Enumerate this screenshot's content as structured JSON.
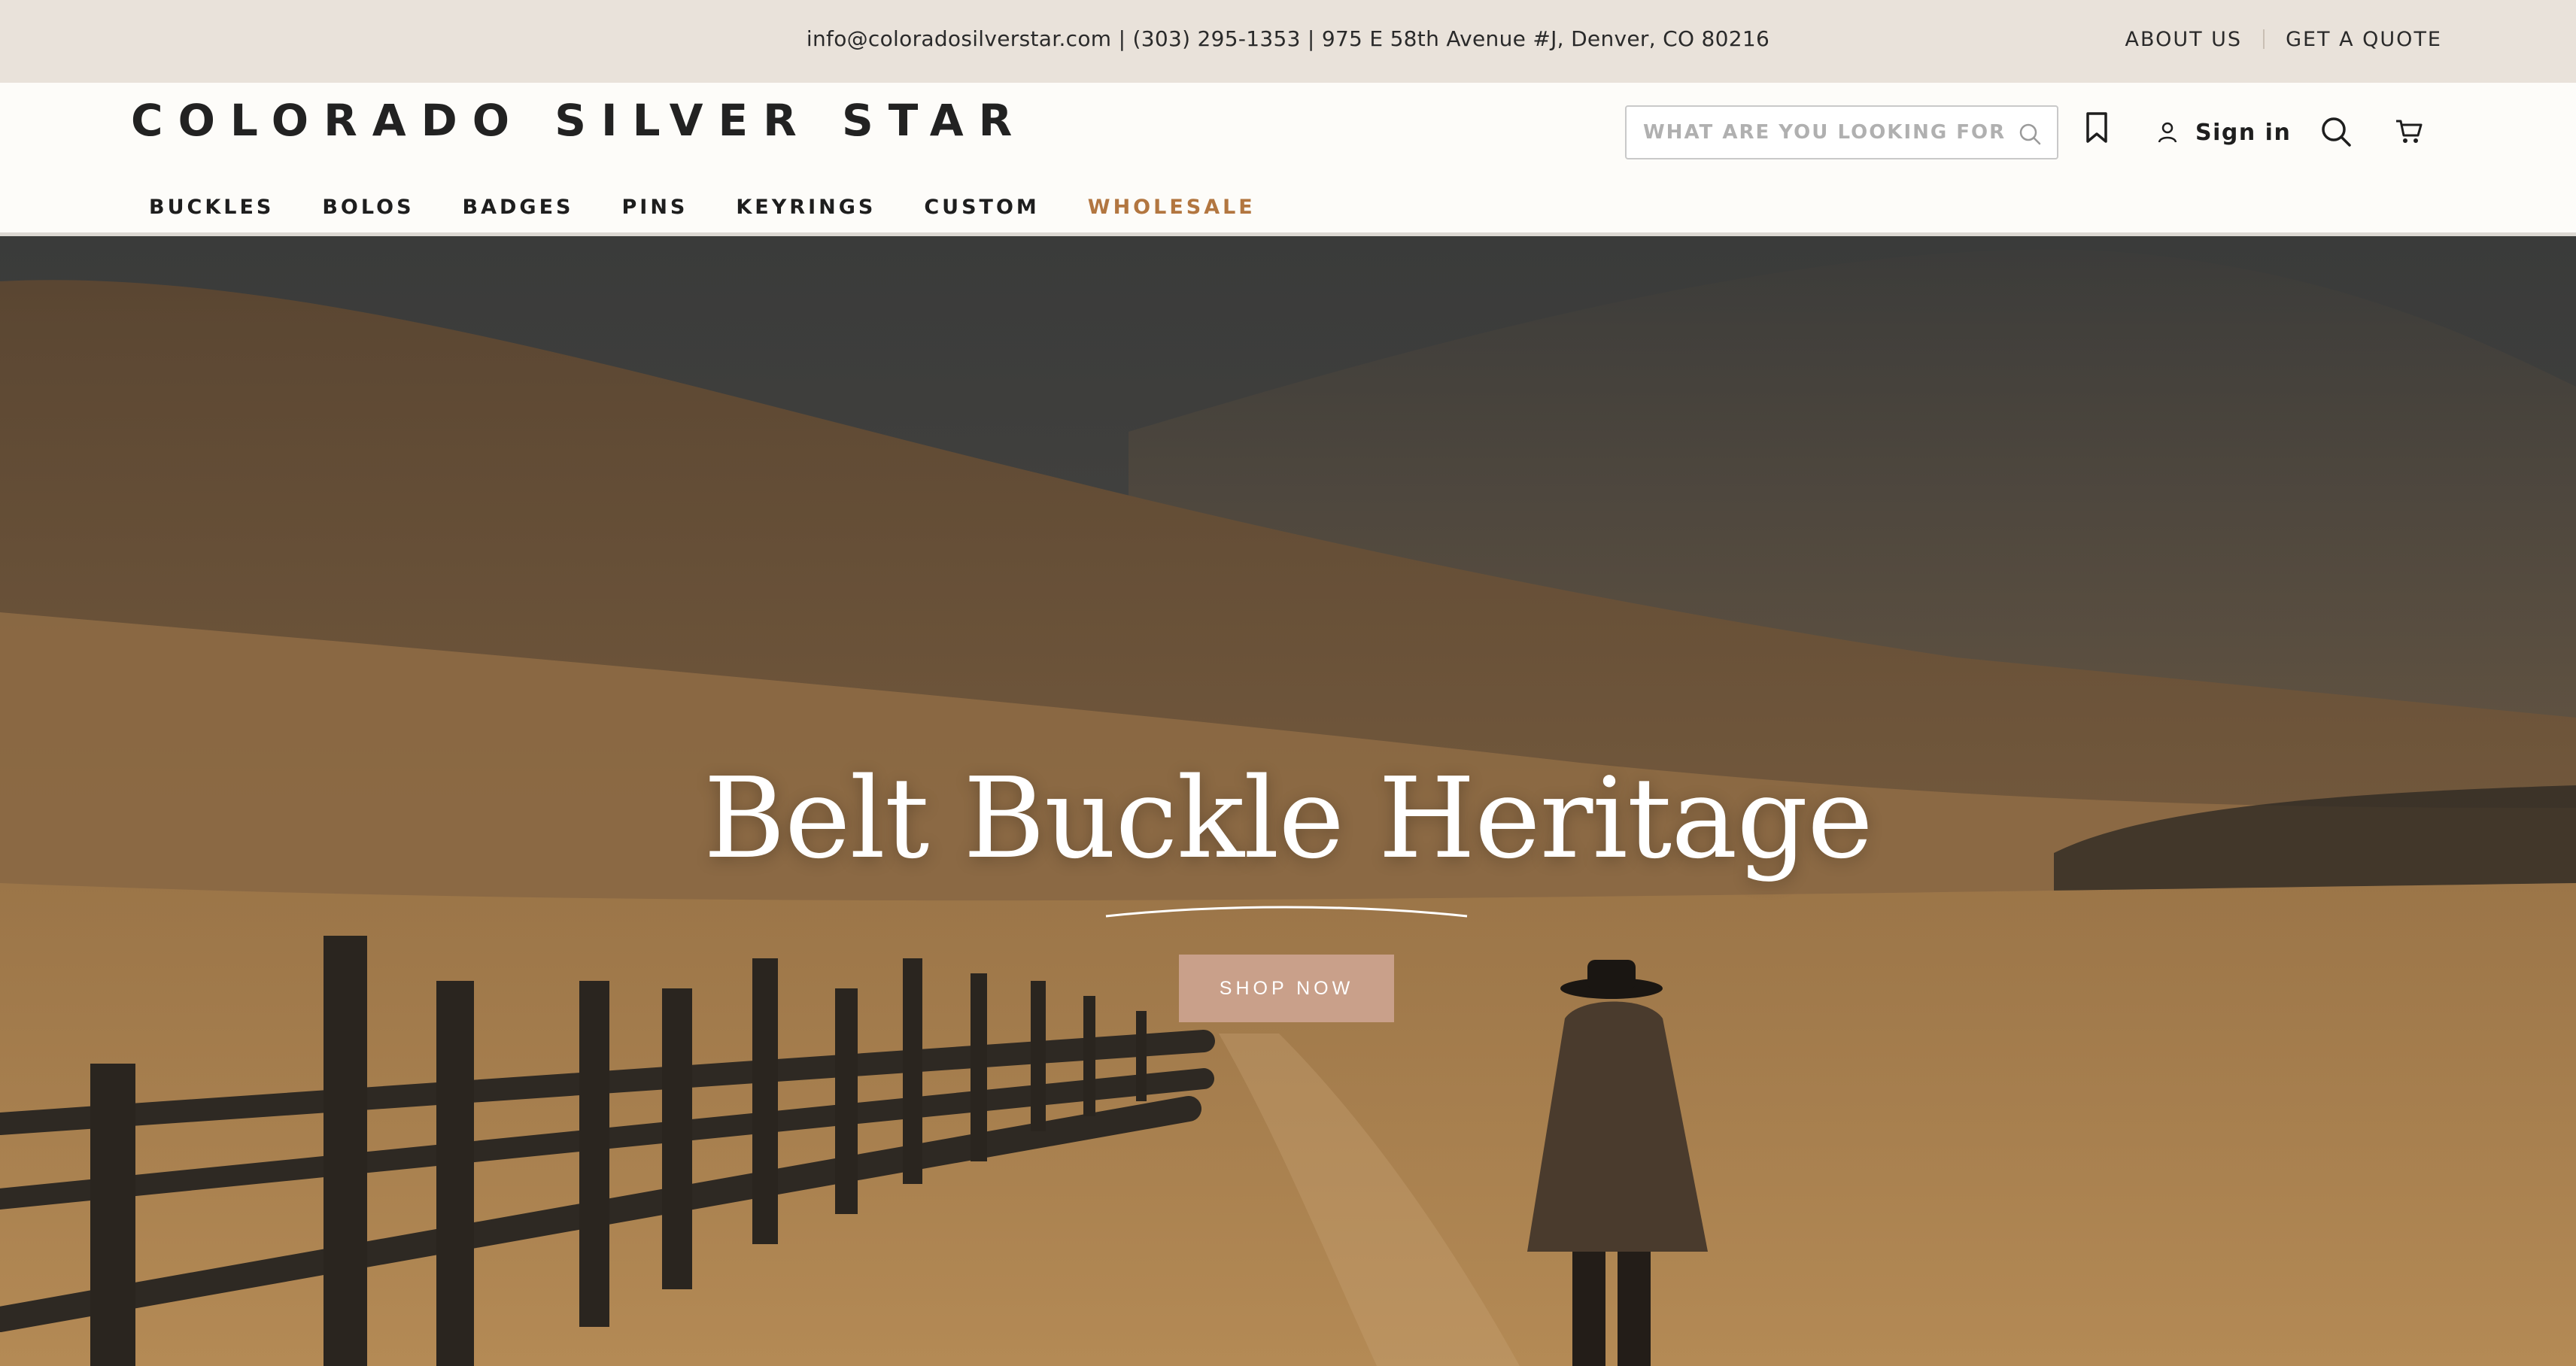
{
  "topbar": {
    "contact": "info@coloradosilverstar.com | (303) 295-1353 | 975 E 58th Avenue #J, Denver, CO 80216",
    "links": [
      "ABOUT US",
      "GET A QUOTE"
    ]
  },
  "header": {
    "logo": "COLORADO SILVER STAR",
    "search_placeholder": "WHAT ARE YOU LOOKING FOR",
    "sign_in": "Sign in",
    "icons": [
      "bookmark-icon",
      "user-icon",
      "search-icon",
      "cart-icon"
    ]
  },
  "nav": {
    "items": [
      "BUCKLES",
      "BOLOS",
      "BADGES",
      "PINS",
      "KEYRINGS",
      "CUSTOM",
      "WHOLESALE"
    ],
    "accent_color": "#b27640"
  },
  "hero": {
    "title": "Belt Buckle Heritage",
    "cta": "SHOP NOW",
    "cta_color": "#c9a08a"
  }
}
